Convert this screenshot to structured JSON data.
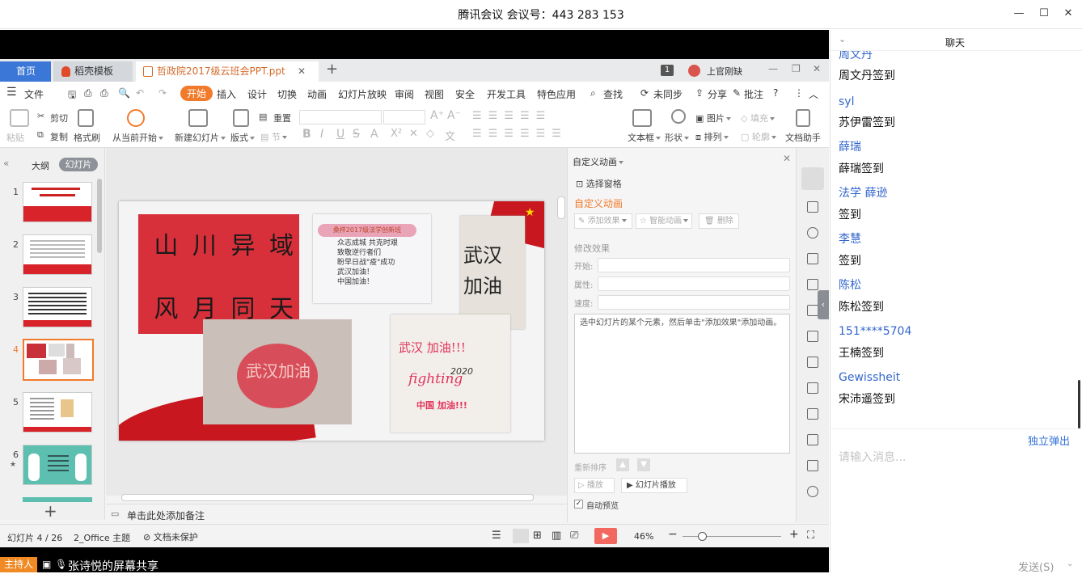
{
  "window": {
    "title": "腾讯会议 会议号：443 283 153",
    "controls": [
      "—",
      "☐",
      "✕"
    ]
  },
  "wps": {
    "tabs": {
      "home": "首页",
      "template": "稻壳模板",
      "document": "哲政院2017级云班会PPT.ppt",
      "add": "+"
    },
    "badge_count": "1",
    "user_name": "上官刚缺",
    "menu": {
      "file": "文件",
      "items": [
        "开始",
        "插入",
        "设计",
        "切换",
        "动画",
        "幻灯片放映",
        "审阅",
        "视图",
        "安全",
        "开发工具",
        "特色应用"
      ],
      "search": "查找",
      "sync": "未同步",
      "share": "分享",
      "comment": "批注"
    },
    "ribbon": {
      "paste": "粘贴",
      "cut": "剪切",
      "copy": "复制",
      "format_painter": "格式刷",
      "from_start": "从当前开始",
      "new_slide": "新建幻灯片",
      "layout": "版式",
      "reset": "重置",
      "section": "节",
      "textbox": "文本框",
      "shape": "形状",
      "picture": "图片",
      "arrange": "排列",
      "fill": "填充",
      "outline": "轮廓",
      "doc_assistant": "文档助手"
    },
    "left_pane": {
      "outline_tab": "大纲",
      "slides_tab": "幻灯片",
      "slide_numbers": [
        "1",
        "2",
        "3",
        "4",
        "5",
        "6"
      ],
      "selected": "4",
      "add": "+"
    },
    "slide": {
      "poster_line1": "山 川 异 域",
      "poster_line2": "风 月 同 天",
      "note_title": "桑梓2017级法学创新班",
      "note_body": "众志成城 共克时艰\n致敬逆行者们\n盼早日战\"疫\"成功\n武汉加油！\n中国加油！",
      "card_wuhan": "武汉\n加油",
      "bottom_card_title": "武汉 加油!!!",
      "bottom_card_fighting": "fighting",
      "bottom_card_year": "2020",
      "bottom_card_china": "中国 加油!!!",
      "drawing_center": "武汉加油"
    },
    "right_panel": {
      "header": "自定义动画",
      "select_pane": "选择窗格",
      "section_title": "自定义动画",
      "add_effect": "添加效果",
      "smart_animation": "智能动画",
      "delete": "删除",
      "modify_effect": "修改效果",
      "start_label": "开始:",
      "property_label": "属性:",
      "speed_label": "速度:",
      "hint": "选中幻灯片的某个元素，然后单击\"添加效果\"添加动画。",
      "reorder": "重新排序",
      "play": "播放",
      "slideshow": "幻灯片播放",
      "auto_preview": "自动预览"
    },
    "notes_placeholder": "单击此处添加备注",
    "status": {
      "slide_info": "幻灯片 4 / 26",
      "theme": "2_Office 主题",
      "protection": "文档未保护",
      "zoom": "46%",
      "minus": "−",
      "plus": "+"
    }
  },
  "share_bar": {
    "host_badge": "主持人",
    "sharer": "张诗悦的屏幕共享"
  },
  "chat": {
    "title": "聊天",
    "messages": [
      {
        "name": "周文丹",
        "text": "周文丹签到"
      },
      {
        "name": "syl",
        "text": "苏伊雷签到"
      },
      {
        "name": "薛瑞",
        "text": "薛瑞签到"
      },
      {
        "name": "法学 薛逊",
        "text": "签到"
      },
      {
        "name": "李慧",
        "text": "签到"
      },
      {
        "name": "陈松",
        "text": "陈松签到"
      },
      {
        "name": "151****5704",
        "text": "王楠签到"
      },
      {
        "name": "Gewissheit",
        "text": "宋沛遥签到"
      }
    ],
    "popout": "独立弹出",
    "input_placeholder": "请输入消息...",
    "send": "发送(S)"
  },
  "colors": {
    "accent_orange": "#f27a2b",
    "tab_blue": "#3a77d6",
    "chat_name_blue": "#3366cc"
  }
}
